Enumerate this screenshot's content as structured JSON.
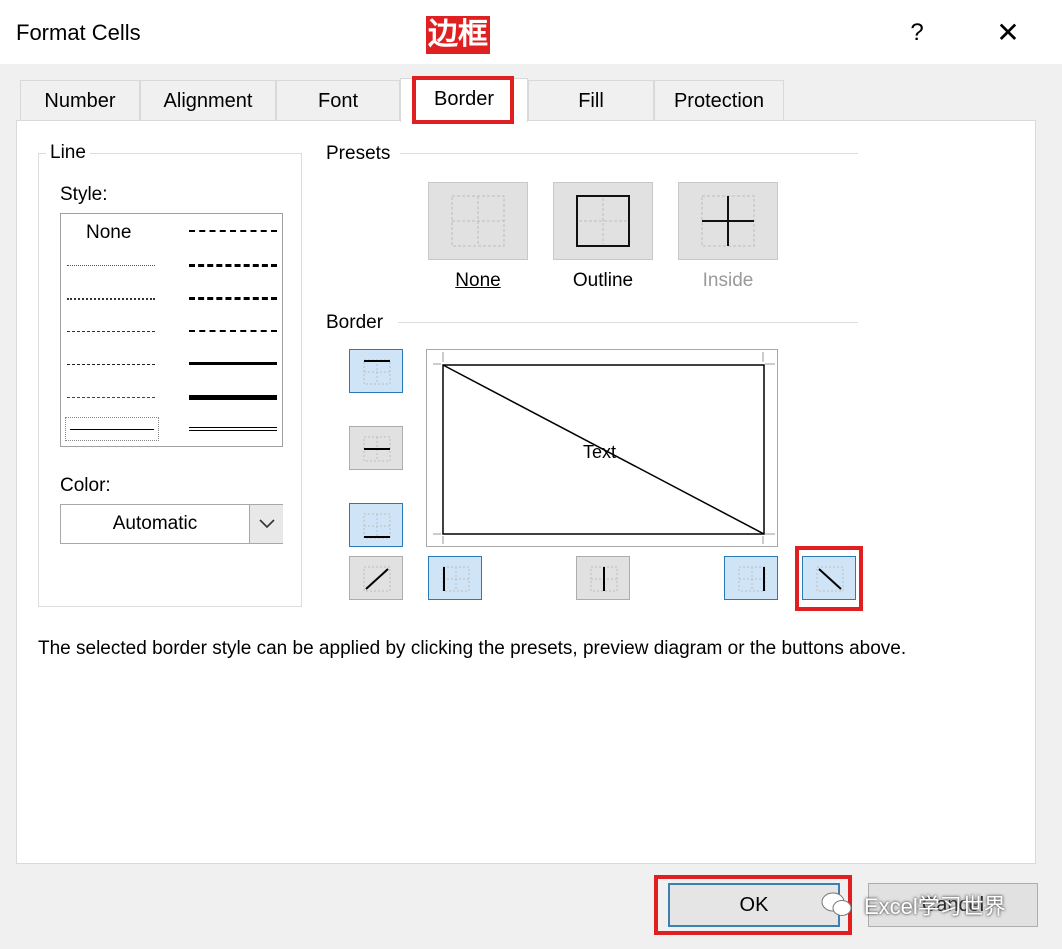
{
  "window": {
    "title": "Format Cells",
    "help": "?",
    "close": "✕"
  },
  "annotation": {
    "label": "边框"
  },
  "tabs": [
    {
      "label": "Number"
    },
    {
      "label": "Alignment"
    },
    {
      "label": "Font"
    },
    {
      "label": "Border",
      "active": true
    },
    {
      "label": "Fill"
    },
    {
      "label": "Protection"
    }
  ],
  "line_group": {
    "title": "Line",
    "style_label": "Style:",
    "style_first_option": "None",
    "color_label": "Color:",
    "color_value": "Automatic"
  },
  "presets": {
    "title": "Presets",
    "items": [
      {
        "label": "None",
        "enabled": true
      },
      {
        "label": "Outline",
        "enabled": true
      },
      {
        "label": "Inside",
        "enabled": false
      }
    ]
  },
  "border": {
    "title": "Border",
    "preview_text": "Text"
  },
  "hint": "The selected border style can be applied by clicking the presets, preview diagram or the buttons above.",
  "buttons": {
    "ok": "OK",
    "cancel": "Cancel"
  },
  "watermark": "Excel学习世界",
  "colors": {
    "annotation_red": "#e02020",
    "selected_blue": "#cfe5f7",
    "accent_border": "#2a7ab5"
  }
}
